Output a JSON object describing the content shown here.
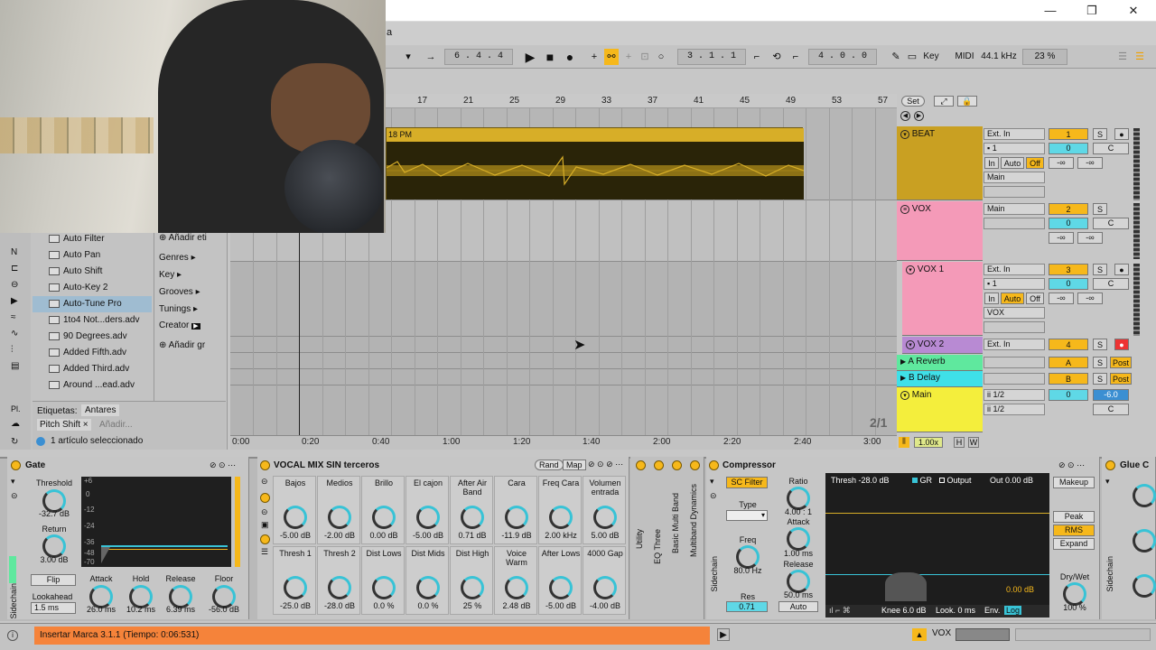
{
  "window": {
    "title_fragment": "a",
    "minimize": "—",
    "maximize": "❐",
    "close": "✕"
  },
  "transport": {
    "position": "6 . 4 . 4",
    "loop_start": "3 . 1 . 1",
    "loop_length": "4 . 0 . 0",
    "key_label": "Key",
    "midi_label": "MIDI",
    "sample_rate": "44.1 kHz",
    "cpu": "23 %"
  },
  "ruler": {
    "bars": [
      "17",
      "21",
      "25",
      "29",
      "33",
      "37",
      "41",
      "45",
      "49",
      "53",
      "57"
    ],
    "set_label": "Set"
  },
  "timeline": {
    "times": [
      "0:00",
      "0:20",
      "0:40",
      "1:00",
      "1:20",
      "1:40",
      "2:00",
      "2:20",
      "2:40",
      "3:00"
    ],
    "zoom": "1.00x",
    "h": "H",
    "w": "W",
    "page": "2/1"
  },
  "clip": {
    "label": "18 PM"
  },
  "browser": {
    "items": [
      "Auto Filter",
      "Auto Pan",
      "Auto Shift",
      "Auto-Key 2",
      "Auto-Tune Pro",
      "1to4 Not...ders.adv",
      "90 Degrees.adv",
      "Added Fifth.adv",
      "Added Third.adv",
      "Around ...ead.adv"
    ],
    "selected_index": 4,
    "tags_label": "Etiquetas:",
    "tag1": "Antares",
    "tag2": "Pitch Shift ×",
    "tag_add": "Añadir...",
    "selection_info": "1 artículo seleccionado",
    "categories": [
      "Añadir eti",
      "Genres ▸",
      "Key ▸",
      "Grooves ▸",
      "Tunings ▸",
      "Creator",
      "Añadir gr"
    ]
  },
  "tracks": [
    {
      "name": "BEAT",
      "input": "Ext. In",
      "channel": "1",
      "route": "Main",
      "number": "1",
      "vol": "0",
      "pan": "C",
      "color": "#c9a022",
      "mon": [
        "In",
        "Auto",
        "Off"
      ],
      "sends": [
        "-∞",
        "-∞"
      ]
    },
    {
      "name": "VOX",
      "input": "Main",
      "number": "2",
      "vol": "0",
      "pan": "C",
      "color": "#f49ab8",
      "sends": [
        "-∞",
        "-∞"
      ]
    },
    {
      "name": "VOX 1",
      "input": "Ext. In",
      "channel": "1",
      "route": "VOX",
      "number": "3",
      "vol": "0",
      "pan": "C",
      "color": "#f49ab8",
      "mon": [
        "In",
        "Auto",
        "Off"
      ],
      "sends": [
        "-∞",
        "-∞"
      ]
    },
    {
      "name": "VOX 2",
      "input": "Ext. In",
      "number": "4",
      "color": "#b88ad3"
    },
    {
      "name": "A Reverb",
      "number": "A",
      "post": "Post",
      "color": "#5fe89e"
    },
    {
      "name": "B Delay",
      "number": "B",
      "post": "Post",
      "color": "#3fe0e8"
    },
    {
      "name": "Main",
      "input": "ii 1/2",
      "output": "ii 1/2",
      "number": "0",
      "vol": "-6.0",
      "pan": "C",
      "color": "#f4ee3c"
    }
  ],
  "devices": {
    "gate": {
      "title": "Gate",
      "threshold_label": "Threshold",
      "threshold": "-32.7 dB",
      "return_label": "Return",
      "return": "3.00 dB",
      "flip": "Flip",
      "lookahead_label": "Lookahead",
      "lookahead": "1.5 ms",
      "sidechain": "Sidechain",
      "knobs": [
        {
          "label": "Attack",
          "value": "26.0 ms"
        },
        {
          "label": "Hold",
          "value": "10.2 ms"
        },
        {
          "label": "Release",
          "value": "6.39 ms"
        },
        {
          "label": "Floor",
          "value": "-56.0 dB"
        }
      ],
      "scale": [
        "+6",
        "0",
        "-12",
        "-24",
        "-36",
        "-48",
        "-70"
      ]
    },
    "rack": {
      "title": "VOCAL MIX SIN terceros",
      "rand": "Rand",
      "map": "Map",
      "row1": [
        {
          "label": "Bajos",
          "value": "-5.00 dB"
        },
        {
          "label": "Medios",
          "value": "-2.00 dB"
        },
        {
          "label": "Brillo",
          "value": "0.00 dB"
        },
        {
          "label": "El cajon",
          "value": "-5.00 dB"
        },
        {
          "label": "After Air Band",
          "value": "0.71 dB"
        },
        {
          "label": "Cara",
          "value": "-11.9 dB"
        },
        {
          "label": "Freq Cara",
          "value": "2.00 kHz"
        },
        {
          "label": "Volumen entrada",
          "value": "5.00 dB"
        }
      ],
      "row2": [
        {
          "label": "Thresh 1",
          "value": "-25.0 dB"
        },
        {
          "label": "Thresh 2",
          "value": "-28.0 dB"
        },
        {
          "label": "Dist Lows",
          "value": "0.0 %"
        },
        {
          "label": "Dist Mids",
          "value": "0.0 %"
        },
        {
          "label": "Dist High",
          "value": "25 %"
        },
        {
          "label": "Voice Warm",
          "value": "2.48 dB"
        },
        {
          "label": "After Lows",
          "value": "-5.00 dB"
        },
        {
          "label": "4000 Gap",
          "value": "-4.00 dB"
        }
      ]
    },
    "chain": [
      "Utility",
      "EQ Three",
      "Basic Multi Band",
      "Multiband Dynamics"
    ],
    "compressor": {
      "title": "Compressor",
      "sc_filter": "SC Filter",
      "type_label": "Type",
      "freq_label": "Freq",
      "freq": "80.0 Hz",
      "res_label": "Res",
      "res": "0.71",
      "ratio_label": "Ratio",
      "ratio": "4.00 : 1",
      "attack_label": "Attack",
      "attack": "1.00 ms",
      "release_label": "Release",
      "release": "50.0 ms",
      "auto": "Auto",
      "thresh": "Thresh -28.0 dB",
      "gr": "GR",
      "output": "Output",
      "out": "Out 0.00 dB",
      "makeup": "Makeup",
      "peak": "Peak",
      "rms": "RMS",
      "expand": "Expand",
      "drywet_label": "Dry/Wet",
      "drywet": "100 %",
      "gr_val": "0.00 dB",
      "knee": "Knee 6.0 dB",
      "look": "Look. 0 ms",
      "env": "Env.",
      "log": "Log",
      "sidechain": "Sidechain"
    },
    "glue": {
      "title": "Glue C"
    }
  },
  "status": {
    "message": "Insertar Marca 3.1.1 (Tiempo: 0:06:531)",
    "track": "VOX"
  }
}
